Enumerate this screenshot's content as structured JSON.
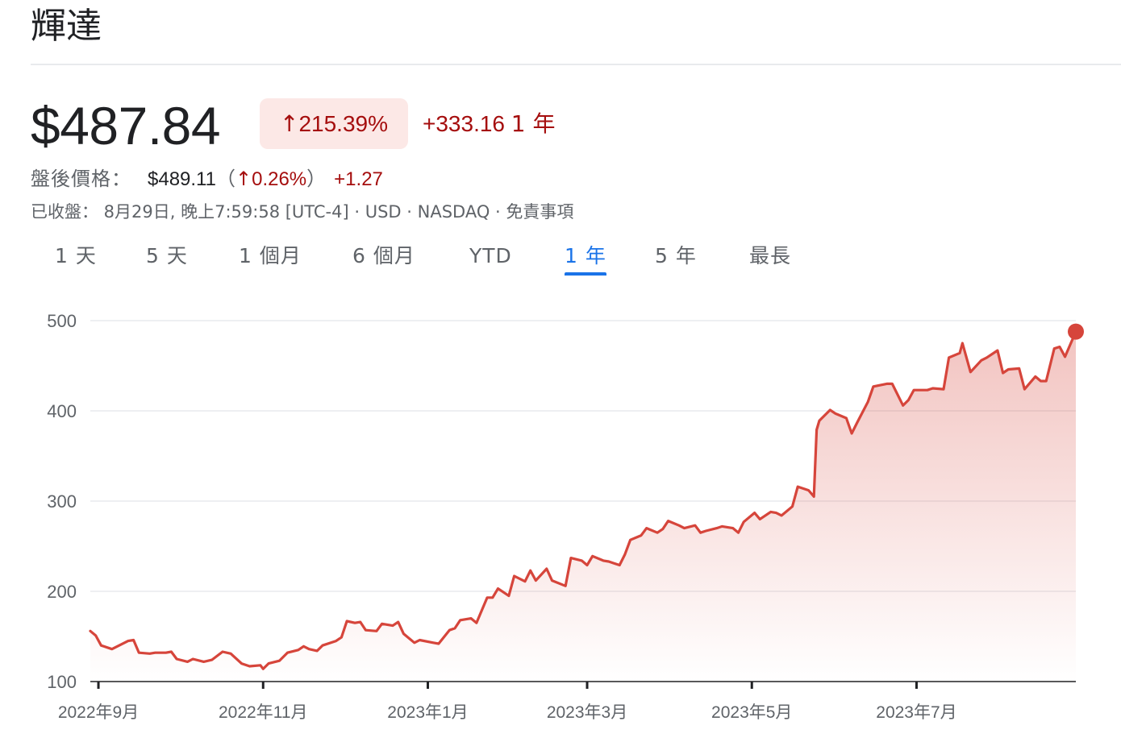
{
  "header": {
    "title": "輝達"
  },
  "quote": {
    "price": "$487.84",
    "change_arrow": "↑",
    "change_percent": "215.39%",
    "change_value": "+333.16",
    "change_period": "1 年",
    "after_hours_label": "盤後價格：",
    "after_hours_price": "$489.11",
    "after_hours_paren_open": "（",
    "after_hours_arrow": "↑",
    "after_hours_percent": "0.26%",
    "after_hours_paren_close": "）",
    "after_hours_change": "+1.27",
    "meta": "已收盤： 8月29日, 晚上7:59:58 [UTC-4] · USD · NASDAQ · 免責事項"
  },
  "tabs": [
    {
      "label": "1 天",
      "active": false
    },
    {
      "label": "5 天",
      "active": false
    },
    {
      "label": "1 個月",
      "active": false
    },
    {
      "label": "6 個月",
      "active": false
    },
    {
      "label": "YTD",
      "active": false
    },
    {
      "label": "1 年",
      "active": true
    },
    {
      "label": "5 年",
      "active": false
    },
    {
      "label": "最長",
      "active": false
    }
  ],
  "colors": {
    "line": "#d6453b",
    "negative_text": "#a50e0e",
    "chip_bg": "#fce8e6",
    "active_tab": "#1a73e8"
  },
  "chart_data": {
    "type": "area",
    "ylim": [
      100,
      500
    ],
    "y_ticks": [
      100,
      200,
      300,
      400,
      500
    ],
    "grid": true,
    "x_start": "2022-08-29",
    "x_end": "2023-08-29",
    "x_ticks": [
      {
        "date": "2022-09-01",
        "label": "2022年9月"
      },
      {
        "date": "2022-11-01",
        "label": "2022年11月"
      },
      {
        "date": "2023-01-01",
        "label": "2023年1月"
      },
      {
        "date": "2023-03-01",
        "label": "2023年3月"
      },
      {
        "date": "2023-05-01",
        "label": "2023年5月"
      },
      {
        "date": "2023-07-01",
        "label": "2023年7月"
      }
    ],
    "series": [
      {
        "values": [
          [
            "2022-08-29",
            156
          ],
          [
            "2022-08-31",
            151
          ],
          [
            "2022-09-02",
            140
          ],
          [
            "2022-09-06",
            136
          ],
          [
            "2022-09-08",
            139
          ],
          [
            "2022-09-12",
            145
          ],
          [
            "2022-09-14",
            146
          ],
          [
            "2022-09-16",
            132
          ],
          [
            "2022-09-20",
            131
          ],
          [
            "2022-09-22",
            132
          ],
          [
            "2022-09-26",
            132
          ],
          [
            "2022-09-28",
            133
          ],
          [
            "2022-09-30",
            125
          ],
          [
            "2022-10-04",
            122
          ],
          [
            "2022-10-06",
            125
          ],
          [
            "2022-10-10",
            122
          ],
          [
            "2022-10-13",
            124
          ],
          [
            "2022-10-17",
            133
          ],
          [
            "2022-10-20",
            131
          ],
          [
            "2022-10-24",
            120
          ],
          [
            "2022-10-27",
            117
          ],
          [
            "2022-10-31",
            118
          ],
          [
            "2022-11-01",
            114
          ],
          [
            "2022-11-03",
            120
          ],
          [
            "2022-11-07",
            123
          ],
          [
            "2022-11-10",
            132
          ],
          [
            "2022-11-14",
            135
          ],
          [
            "2022-11-16",
            139
          ],
          [
            "2022-11-18",
            136
          ],
          [
            "2022-11-21",
            134
          ],
          [
            "2022-11-23",
            140
          ],
          [
            "2022-11-28",
            145
          ],
          [
            "2022-11-30",
            149
          ],
          [
            "2022-12-02",
            167
          ],
          [
            "2022-12-05",
            165
          ],
          [
            "2022-12-07",
            166
          ],
          [
            "2022-12-09",
            157
          ],
          [
            "2022-12-13",
            156
          ],
          [
            "2022-12-15",
            164
          ],
          [
            "2022-12-19",
            162
          ],
          [
            "2022-12-21",
            166
          ],
          [
            "2022-12-23",
            153
          ],
          [
            "2022-12-27",
            143
          ],
          [
            "2022-12-29",
            146
          ],
          [
            "2023-01-03",
            143
          ],
          [
            "2023-01-05",
            142
          ],
          [
            "2023-01-09",
            157
          ],
          [
            "2023-01-11",
            159
          ],
          [
            "2023-01-13",
            168
          ],
          [
            "2023-01-17",
            170
          ],
          [
            "2023-01-19",
            165
          ],
          [
            "2023-01-23",
            193
          ],
          [
            "2023-01-25",
            193
          ],
          [
            "2023-01-27",
            203
          ],
          [
            "2023-01-31",
            195
          ],
          [
            "2023-02-02",
            217
          ],
          [
            "2023-02-06",
            211
          ],
          [
            "2023-02-08",
            223
          ],
          [
            "2023-02-10",
            212
          ],
          [
            "2023-02-14",
            225
          ],
          [
            "2023-02-16",
            212
          ],
          [
            "2023-02-21",
            206
          ],
          [
            "2023-02-23",
            237
          ],
          [
            "2023-02-27",
            234
          ],
          [
            "2023-03-01",
            229
          ],
          [
            "2023-03-03",
            239
          ],
          [
            "2023-03-07",
            234
          ],
          [
            "2023-03-09",
            233
          ],
          [
            "2023-03-13",
            229
          ],
          [
            "2023-03-15",
            241
          ],
          [
            "2023-03-17",
            257
          ],
          [
            "2023-03-21",
            262
          ],
          [
            "2023-03-23",
            270
          ],
          [
            "2023-03-27",
            265
          ],
          [
            "2023-03-29",
            269
          ],
          [
            "2023-03-31",
            278
          ],
          [
            "2023-04-04",
            273
          ],
          [
            "2023-04-06",
            270
          ],
          [
            "2023-04-10",
            273
          ],
          [
            "2023-04-12",
            265
          ],
          [
            "2023-04-14",
            267
          ],
          [
            "2023-04-18",
            270
          ],
          [
            "2023-04-20",
            272
          ],
          [
            "2023-04-24",
            270
          ],
          [
            "2023-04-26",
            265
          ],
          [
            "2023-04-28",
            277
          ],
          [
            "2023-05-02",
            287
          ],
          [
            "2023-05-04",
            280
          ],
          [
            "2023-05-08",
            288
          ],
          [
            "2023-05-10",
            287
          ],
          [
            "2023-05-12",
            284
          ],
          [
            "2023-05-16",
            294
          ],
          [
            "2023-05-18",
            316
          ],
          [
            "2023-05-22",
            312
          ],
          [
            "2023-05-24",
            305
          ],
          [
            "2023-05-25",
            379
          ],
          [
            "2023-05-26",
            389
          ],
          [
            "2023-05-30",
            401
          ],
          [
            "2023-06-01",
            397
          ],
          [
            "2023-06-05",
            392
          ],
          [
            "2023-06-07",
            375
          ],
          [
            "2023-06-09",
            387
          ],
          [
            "2023-06-13",
            410
          ],
          [
            "2023-06-15",
            427
          ],
          [
            "2023-06-20",
            430
          ],
          [
            "2023-06-22",
            430
          ],
          [
            "2023-06-26",
            406
          ],
          [
            "2023-06-28",
            412
          ],
          [
            "2023-06-30",
            423
          ],
          [
            "2023-07-05",
            423
          ],
          [
            "2023-07-07",
            425
          ],
          [
            "2023-07-11",
            424
          ],
          [
            "2023-07-13",
            459
          ],
          [
            "2023-07-17",
            464
          ],
          [
            "2023-07-18",
            475
          ],
          [
            "2023-07-21",
            443
          ],
          [
            "2023-07-25",
            456
          ],
          [
            "2023-07-27",
            459
          ],
          [
            "2023-07-31",
            467
          ],
          [
            "2023-08-02",
            442
          ],
          [
            "2023-08-04",
            446
          ],
          [
            "2023-08-08",
            447
          ],
          [
            "2023-08-10",
            424
          ],
          [
            "2023-08-14",
            438
          ],
          [
            "2023-08-16",
            433
          ],
          [
            "2023-08-18",
            433
          ],
          [
            "2023-08-21",
            469
          ],
          [
            "2023-08-23",
            471
          ],
          [
            "2023-08-25",
            460
          ],
          [
            "2023-08-29",
            487.84
          ]
        ]
      }
    ]
  }
}
